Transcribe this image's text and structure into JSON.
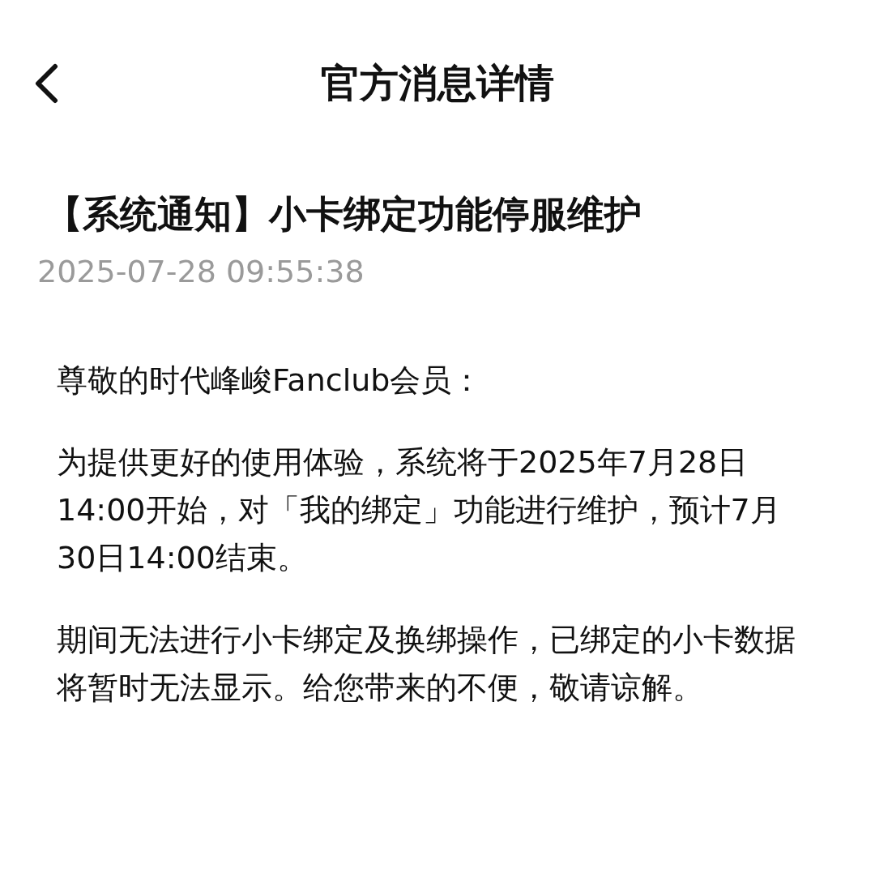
{
  "header": {
    "title": "官方消息详情"
  },
  "message": {
    "title": "【系统通知】小卡绑定功能停服维护",
    "time": "2025-07-28 09:55:38",
    "paragraphs": [
      "尊敬的时代峰峻Fanclub会员：",
      "为提供更好的使用体验，系统将于2025年7月28日14:00开始，对「我的绑定」功能进行维护，预计7月30日14:00结束。",
      "期间无法进行小卡绑定及换绑操作，已绑定的小卡数据将暂时无法显示。给您带来的不便，敬请谅解。"
    ]
  }
}
